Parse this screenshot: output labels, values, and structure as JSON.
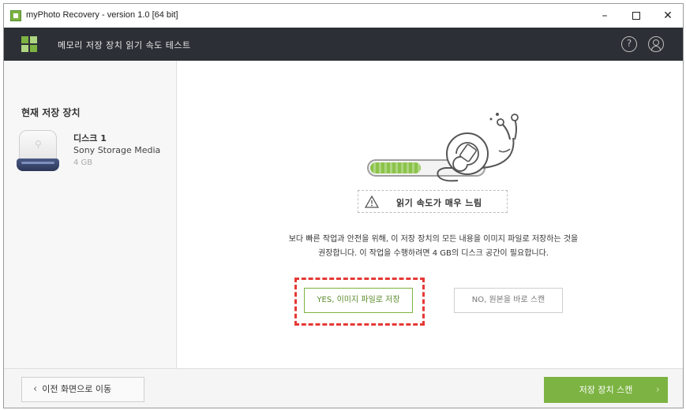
{
  "window": {
    "title": "myPhoto Recovery - version 1.0 [64 bit]",
    "minimize_label": "–",
    "close_label": "✕"
  },
  "header": {
    "title": "메모리 저장 장치 읽기 속도 테스트",
    "help_icon": "question-circle-icon",
    "user_icon": "user-circle-icon",
    "help_glyph": "?"
  },
  "sidebar": {
    "heading": "현재 저장 장치",
    "device": {
      "name": "디스크 1",
      "model": "Sony Storage Media",
      "size": "4 GB",
      "icon": "usb-drive-icon"
    }
  },
  "main": {
    "read_progress": 0.45,
    "warning_icon": "warning-triangle-icon",
    "warning_text": "읽기 속도가 매우 느림",
    "description_line1": "보다 빠른 작업과 안전을 위해, 이 저장 장치의 모든 내용을 이미지 파일로 저장하는 것을",
    "description_line2": "권장합니다. 이 작업을 수행하려면 4 GB의 디스크 공간이 필요합니다.",
    "yes_button": "YES, 이미지 파일로 저장",
    "no_button": "NO, 원본을 바로 스캔",
    "highlight_color": "#e53935"
  },
  "footer": {
    "back_button": "이전 화면으로 이동",
    "scan_button": "저장 장치 스캔"
  },
  "colors": {
    "accent": "#7cb342",
    "header_bg": "#2c2f35"
  }
}
